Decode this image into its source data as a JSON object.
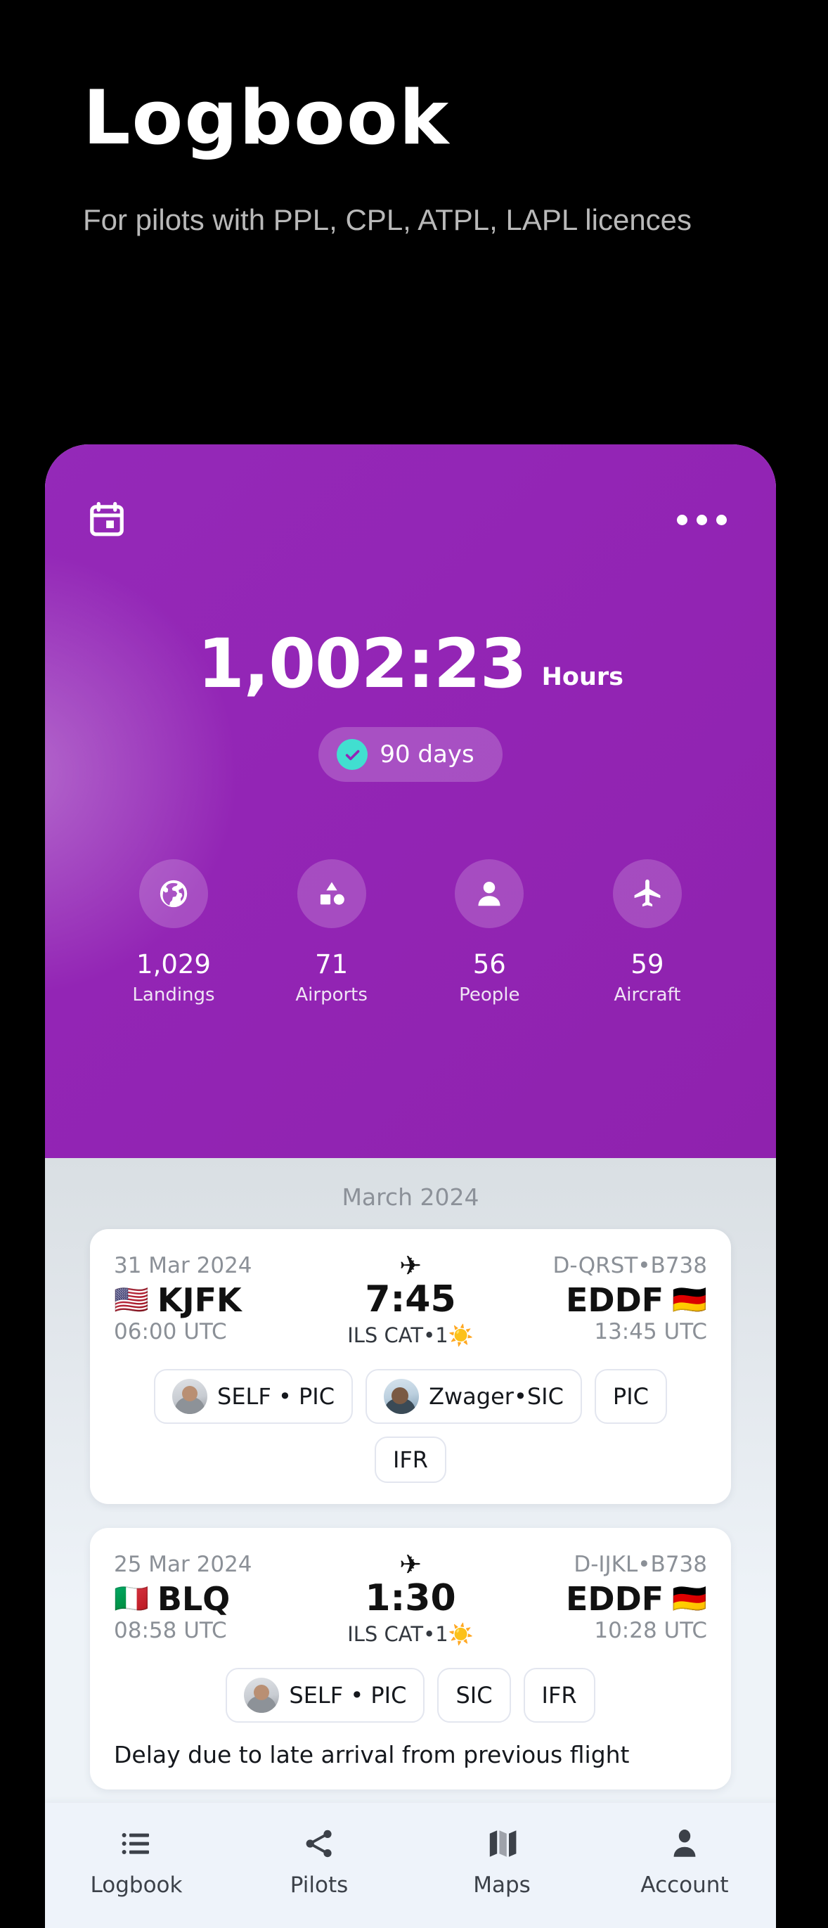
{
  "hero": {
    "title": "Logbook",
    "subtitle": "For pilots with PPL, CPL, ATPL, LAPL licences"
  },
  "app": {
    "header": {
      "calendar_icon": "calendar-icon",
      "overflow_icon": "more-options-icon",
      "total_hours": "1,002:23",
      "hours_label": "Hours",
      "period_badge": {
        "icon": "check-circle-icon",
        "label": "90 days",
        "accent": "#41dfd0"
      },
      "background_color": "#9325b5",
      "stats": [
        {
          "icon": "globe-icon",
          "value": "1,029",
          "label": "Landings"
        },
        {
          "icon": "shapes-icon",
          "value": "71",
          "label": "Airports"
        },
        {
          "icon": "person-icon",
          "value": "56",
          "label": "People"
        },
        {
          "icon": "airplane-icon",
          "value": "59",
          "label": "Aircraft"
        }
      ]
    },
    "list": {
      "month_label": "March 2024",
      "flights": [
        {
          "date": "31 Mar 2024",
          "dep_flag": "🇺🇸",
          "dep_code": "KJFK",
          "dep_time": "06:00 UTC",
          "plane_icon": "airplane-icon",
          "duration": "7:45",
          "approach": "ILS CAT•1☀️",
          "aircraft": "D-QRST•B738",
          "arr_flag": "🇩🇪",
          "arr_code": "EDDF",
          "arr_time": "13:45 UTC",
          "tags": [
            {
              "avatar": "avatar-self",
              "label": "SELF • PIC"
            },
            {
              "avatar": "avatar-zwager",
              "label": "Zwager•SIC"
            },
            {
              "avatar": null,
              "label": "PIC"
            },
            {
              "avatar": null,
              "label": "IFR"
            }
          ],
          "note": null
        },
        {
          "date": "25 Mar 2024",
          "dep_flag": "🇮🇹",
          "dep_code": "BLQ",
          "dep_time": "08:58 UTC",
          "plane_icon": "airplane-icon",
          "duration": "1:30",
          "approach": "ILS CAT•1☀️",
          "aircraft": "D-IJKL•B738",
          "arr_flag": "🇩🇪",
          "arr_code": "EDDF",
          "arr_time": "10:28 UTC",
          "tags": [
            {
              "avatar": "avatar-self",
              "label": "SELF • PIC"
            },
            {
              "avatar": null,
              "label": "SIC"
            },
            {
              "avatar": null,
              "label": "IFR"
            }
          ],
          "note": "Delay due to late arrival from previous flight"
        }
      ]
    },
    "bottom_nav": [
      {
        "icon": "list-icon",
        "label": "Logbook"
      },
      {
        "icon": "share-icon",
        "label": "Pilots"
      },
      {
        "icon": "map-icon",
        "label": "Maps"
      },
      {
        "icon": "person-icon",
        "label": "Account"
      }
    ]
  }
}
